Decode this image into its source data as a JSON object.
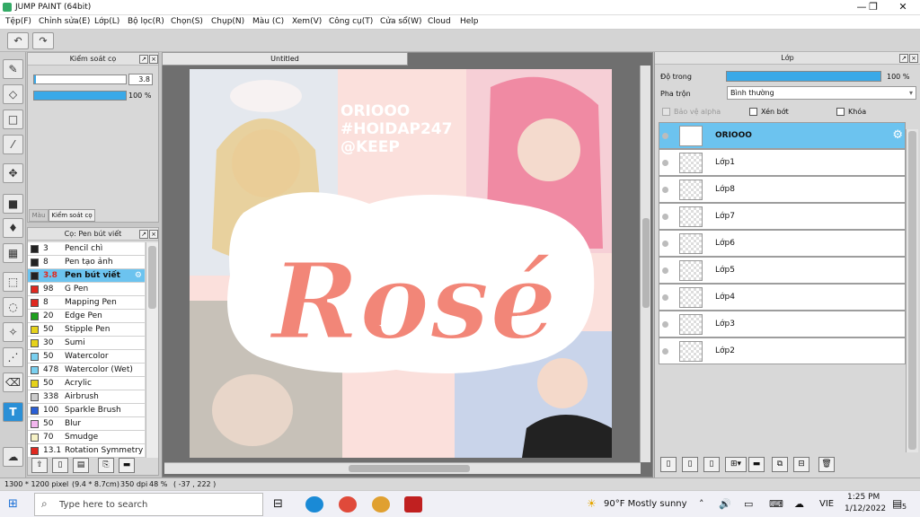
{
  "app": {
    "title": "JUMP PAINT (64bit)"
  },
  "menu": [
    "Tệp(F)",
    "Chỉnh sửa(E)",
    "Lớp(L)",
    "Bộ lọc(R)",
    "Chọn(S)",
    "Chụp(N)",
    "Màu (C)",
    "Xem(V)",
    "Công cụ(T)",
    "Cửa sổ(W)",
    "Cloud",
    "Help"
  ],
  "window_buttons": [
    "—",
    "❐",
    "✕"
  ],
  "toolbar": {
    "undo": "↶",
    "redo": "↷"
  },
  "control_panel": {
    "title": "Kiểm soát cọ",
    "size_value": "3.8",
    "opacity_value": "100 %",
    "size_fill": 0.02,
    "opacity_fill": 1.0,
    "tab_color": "Màu",
    "tab_control": "Kiểm soát cọ"
  },
  "brush_panel": {
    "title": "Cọ: Pen bút viết",
    "items": [
      {
        "size": "3",
        "name": "Pencil chì",
        "color": "#222222"
      },
      {
        "size": "8",
        "name": "Pen tạo ảnh",
        "color": "#222222"
      },
      {
        "size": "3.8",
        "name": "Pen bút viết",
        "color": "#222222"
      },
      {
        "size": "98",
        "name": "G Pen",
        "color": "#e0281f"
      },
      {
        "size": "8",
        "name": "Mapping Pen",
        "color": "#e0281f"
      },
      {
        "size": "20",
        "name": "Edge Pen",
        "color": "#1ea01e"
      },
      {
        "size": "50",
        "name": "Stipple Pen",
        "color": "#e6d21a"
      },
      {
        "size": "30",
        "name": "Sumi",
        "color": "#e6d21a"
      },
      {
        "size": "50",
        "name": "Watercolor",
        "color": "#7ad0f0"
      },
      {
        "size": "478",
        "name": "Watercolor (Wet)",
        "color": "#7ad0f0"
      },
      {
        "size": "50",
        "name": "Acrylic",
        "color": "#e6d21a"
      },
      {
        "size": "338",
        "name": "Airbrush",
        "color": "#cccccc"
      },
      {
        "size": "100",
        "name": "Sparkle Brush",
        "color": "#2a5fd6"
      },
      {
        "size": "50",
        "name": "Blur",
        "color": "#f2b6ee"
      },
      {
        "size": "70",
        "name": "Smudge",
        "color": "#f6f2c6"
      },
      {
        "size": "13.1",
        "name": "Rotation Symmetry Pe",
        "color": "#e0281f"
      }
    ]
  },
  "document": {
    "tab": "Untitled",
    "canvas_text": [
      "ORIOOO",
      "#HOIDAP247",
      "@KEEP"
    ],
    "big_word": "Rosé"
  },
  "layer_panel": {
    "title": "Lớp",
    "opacity_label": "Độ trong",
    "opacity_value": "100 %",
    "blend_label": "Pha trộn",
    "blend_value": "Bình thường",
    "check_protect": "Bảo vệ alpha",
    "check_clip": "Xén bớt",
    "check_lock": "Khóa",
    "layers": [
      "ORIOOO",
      "Lớp1",
      "Lớp8",
      "Lớp7",
      "Lớp6",
      "Lớp5",
      "Lớp4",
      "Lớp3",
      "Lớp2"
    ]
  },
  "status": {
    "dims": "1300 * 1200 pixel",
    "size_cm": "(9.4 * 8.7cm)",
    "dpi": "350 dpi",
    "zoom": "48 %",
    "coords": "( -37 , 222 )"
  },
  "taskbar": {
    "search_placeholder": "Type here to search",
    "weather": "90°F  Mostly sunny",
    "lang": "VIE",
    "time": "1:25 PM",
    "date": "1/12/2022",
    "notif": "5"
  }
}
